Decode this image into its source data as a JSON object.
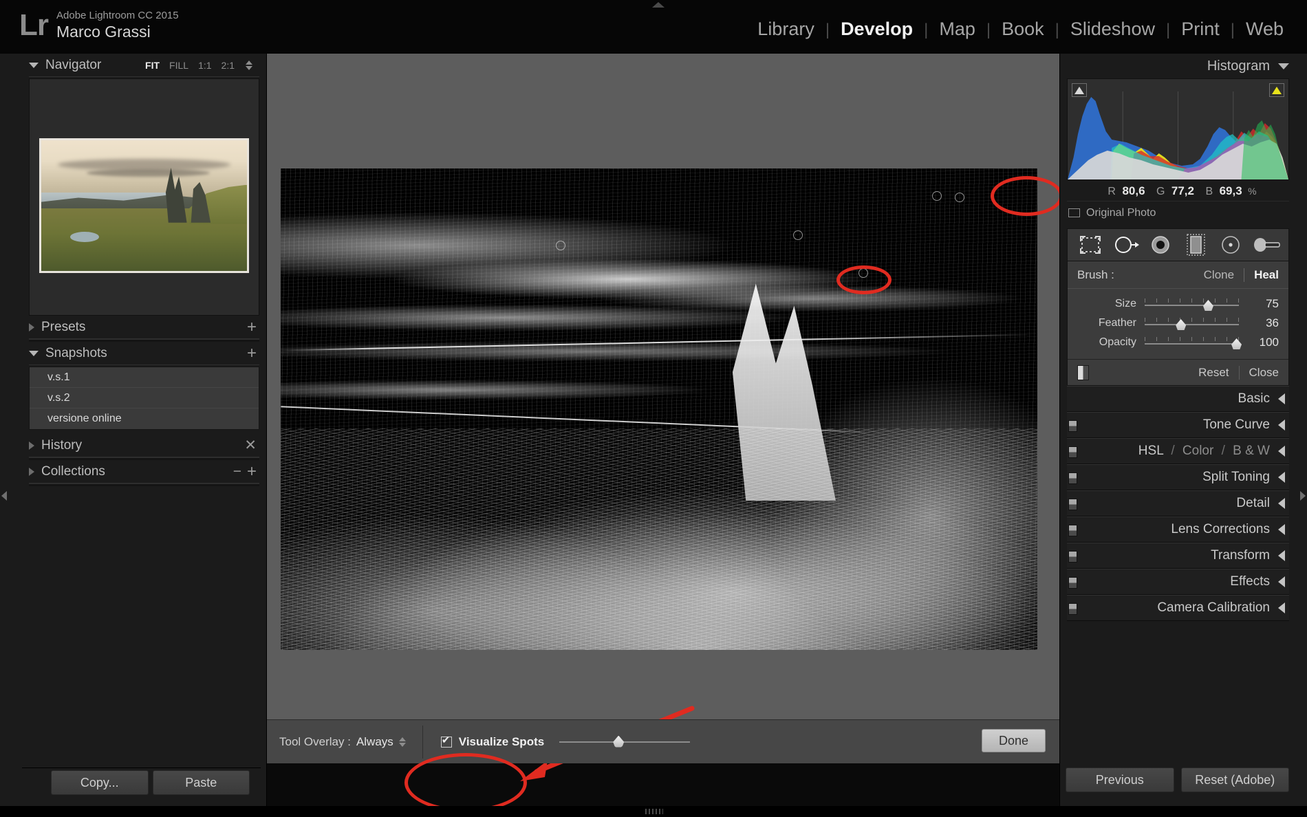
{
  "app": {
    "logo": "Lr",
    "product": "Adobe Lightroom CC 2015",
    "identity": "Marco Grassi"
  },
  "topnav": {
    "items": [
      {
        "label": "Library",
        "active": false
      },
      {
        "label": "Develop",
        "active": true
      },
      {
        "label": "Map",
        "active": false
      },
      {
        "label": "Book",
        "active": false
      },
      {
        "label": "Slideshow",
        "active": false
      },
      {
        "label": "Print",
        "active": false
      },
      {
        "label": "Web",
        "active": false
      }
    ],
    "separator": "|"
  },
  "left_panel": {
    "navigator": {
      "title": "Navigator",
      "zoom_levels": [
        {
          "label": "FIT",
          "active": true
        },
        {
          "label": "FILL",
          "active": false
        },
        {
          "label": "1:1",
          "active": false
        },
        {
          "label": "2:1",
          "active": false
        }
      ]
    },
    "presets": {
      "title": "Presets",
      "add": "+"
    },
    "snapshots": {
      "title": "Snapshots",
      "add": "+",
      "items": [
        "v.s.1",
        "v.s.2",
        "versione online"
      ]
    },
    "history": {
      "title": "History",
      "clear": "✕"
    },
    "collections": {
      "title": "Collections",
      "minus": "−",
      "plus": "+"
    },
    "buttons": {
      "copy": "Copy...",
      "paste": "Paste"
    }
  },
  "right_panel": {
    "histogram": {
      "title": "Histogram",
      "readout": {
        "r_label": "R",
        "r_value": "80,6",
        "g_label": "G",
        "g_value": "77,2",
        "b_label": "B",
        "b_value": "69,3",
        "unit": "%"
      },
      "original_photo": "Original Photo"
    },
    "tools": [
      {
        "name": "crop-overlay-tool"
      },
      {
        "name": "spot-removal-tool"
      },
      {
        "name": "red-eye-correction-tool"
      },
      {
        "name": "graduated-filter-tool"
      },
      {
        "name": "radial-filter-tool"
      },
      {
        "name": "adjustment-brush-tool"
      }
    ],
    "spot_removal": {
      "brush_label": "Brush :",
      "clone": "Clone",
      "heal": "Heal",
      "active_mode": "Heal",
      "sliders": [
        {
          "name": "Size",
          "value": "75",
          "pct": 62
        },
        {
          "name": "Feather",
          "value": "36",
          "pct": 33
        },
        {
          "name": "Opacity",
          "value": "100",
          "pct": 92
        }
      ],
      "reset": "Reset",
      "close": "Close"
    },
    "sections": [
      {
        "label": "Basic",
        "has_switch": false
      },
      {
        "label": "Tone Curve",
        "has_switch": true
      },
      {
        "label": "HSL / Color / B & W",
        "has_switch": true,
        "multi": [
          "HSL",
          "Color",
          "B & W"
        ]
      },
      {
        "label": "Split Toning",
        "has_switch": true
      },
      {
        "label": "Detail",
        "has_switch": true
      },
      {
        "label": "Lens Corrections",
        "has_switch": true
      },
      {
        "label": "Transform",
        "has_switch": true
      },
      {
        "label": "Effects",
        "has_switch": true
      },
      {
        "label": "Camera Calibration",
        "has_switch": true
      }
    ],
    "buttons": {
      "previous": "Previous",
      "reset": "Reset (Adobe)"
    }
  },
  "toolbar": {
    "tool_overlay_label": "Tool Overlay :",
    "tool_overlay_value": "Always",
    "visualize_spots_label": "Visualize Spots",
    "visualize_spots_checked": true,
    "visualize_slider_pct": 41,
    "done": "Done"
  },
  "annotations": {
    "ellipse_spot_1": "red-ellipse-around-dust-spot-upper-right",
    "ellipse_spot_2": "red-ellipse-around-dust-spot-center",
    "ellipse_visualize": "red-ellipse-around-visualize-spots-checkbox",
    "arrow": "red-arrow-pointing-to-visualize-spots",
    "color": "#e02b20"
  },
  "canvas": {
    "view_mode": "visualize-spots-edge-detection",
    "image_subject": "Old Man of Storr landscape"
  }
}
